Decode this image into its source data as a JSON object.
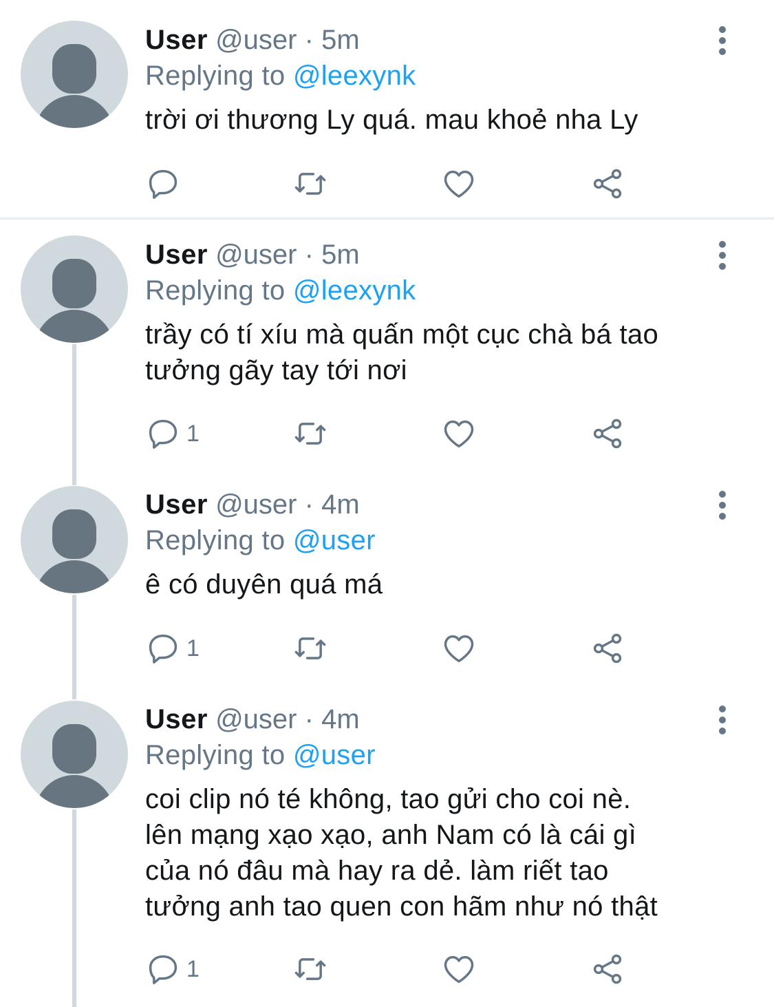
{
  "tweets": [
    {
      "name": "User",
      "handle": "@user",
      "dot": "·",
      "time": "5m",
      "replying_prefix": "Replying to ",
      "replying_to": "@leexynk",
      "text_lines": [
        "trời ơi thương Ly quá. mau khoẻ nha Ly"
      ],
      "reply_count": ""
    },
    {
      "name": "User",
      "handle": "@user",
      "dot": "·",
      "time": "5m",
      "replying_prefix": "Replying to ",
      "replying_to": "@leexynk",
      "text_lines": [
        "trầy có tí xíu mà quấn một cục chà bá tao",
        "tưởng gãy tay tới nơi"
      ],
      "reply_count": "1"
    },
    {
      "name": "User",
      "handle": "@user",
      "dot": "·",
      "time": "4m",
      "replying_prefix": "Replying to ",
      "replying_to": "@user",
      "text_lines": [
        "ê có duyên quá má"
      ],
      "reply_count": "1"
    },
    {
      "name": "User",
      "handle": "@user",
      "dot": "·",
      "time": "4m",
      "replying_prefix": "Replying to ",
      "replying_to": "@user",
      "text_lines": [
        "coi clip nó té không, tao gửi cho coi nè.",
        "lên mạng xạo xạo, anh Nam có là cái gì",
        "của nó đâu mà hay ra dẻ. làm riết tao",
        "tưởng anh tao quen con hãm như nó thật"
      ],
      "reply_count": "1"
    }
  ],
  "icons": {
    "reply": "reply-icon",
    "retweet": "retweet-icon",
    "like": "heart-icon",
    "share": "share-icon",
    "more": "more-vertical-icon"
  },
  "colors": {
    "text": "#14171a",
    "secondary": "#657786",
    "link": "#1da1f2",
    "avatar_bg": "#cfd9de",
    "avatar_fg": "#66757f",
    "separator": "#e6ecf0"
  }
}
